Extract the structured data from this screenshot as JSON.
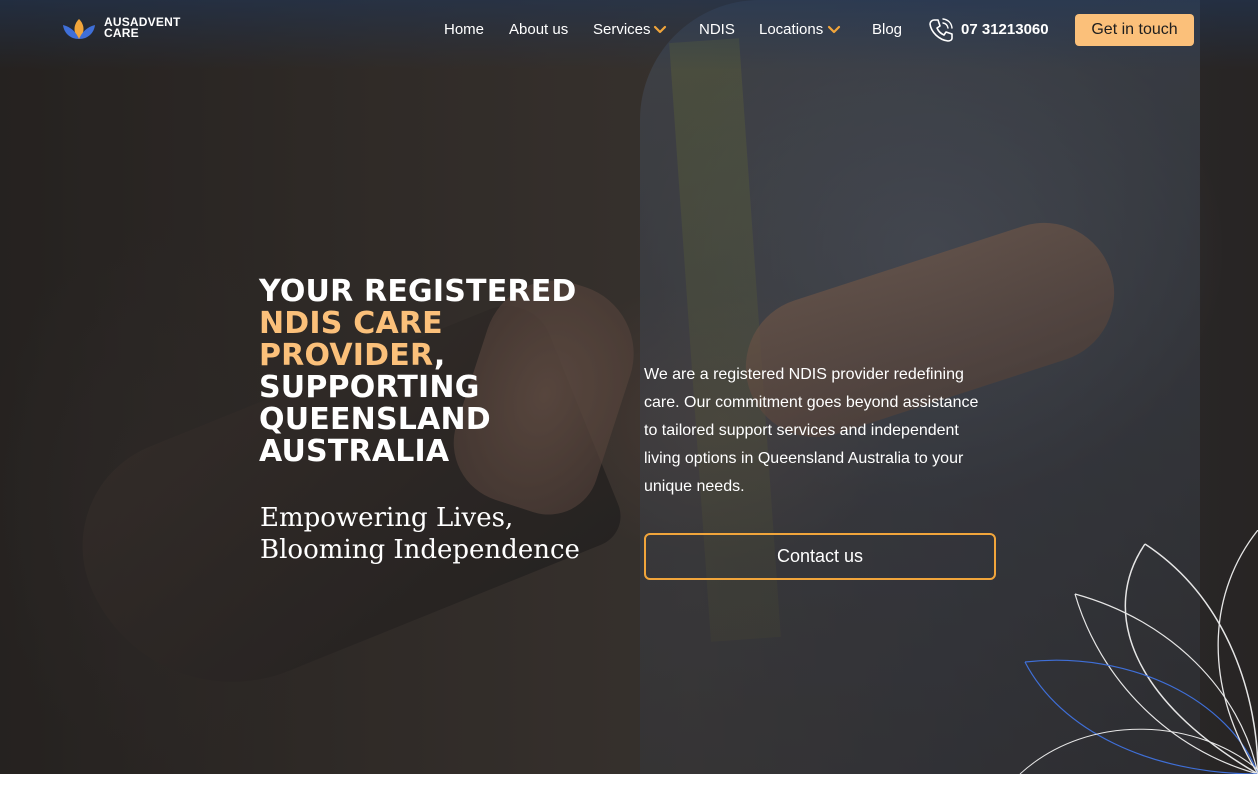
{
  "brand": {
    "name_line1": "AUSADVENT",
    "name_line2": "CARE"
  },
  "nav": {
    "items": [
      {
        "label": "Home"
      },
      {
        "label": "About us"
      },
      {
        "label": "Services",
        "has_dropdown": true
      },
      {
        "label": "NDIS"
      },
      {
        "label": "Locations",
        "has_dropdown": true
      },
      {
        "label": "Blog"
      }
    ],
    "phone": "07 31213060",
    "cta": "Get in touch"
  },
  "hero": {
    "headline_line1": "YOUR REGISTERED",
    "headline_accent_line1": "NDIS CARE",
    "headline_accent_line2": "PROVIDER",
    "headline_comma": ",",
    "headline_line4": "SUPPORTING",
    "headline_line5": "QUEENSLAND",
    "headline_line6": "AUSTRALIA",
    "tagline": "Empowering Lives, Blooming Independence",
    "description": "We are a registered NDIS provider redefining care. Our commitment goes beyond assistance to tailored support services and independent living options in Queensland Australia to your unique needs.",
    "button": "Contact us"
  },
  "colors": {
    "accent": "#fbc07a",
    "button_border": "#f1a53b",
    "logo_blue": "#3f6fd8",
    "logo_orange": "#f1a53b"
  },
  "icons": {
    "logo": "lotus-icon",
    "phone": "phone-icon",
    "dropdown": "chevron-down-icon",
    "decor": "petals-outline"
  }
}
